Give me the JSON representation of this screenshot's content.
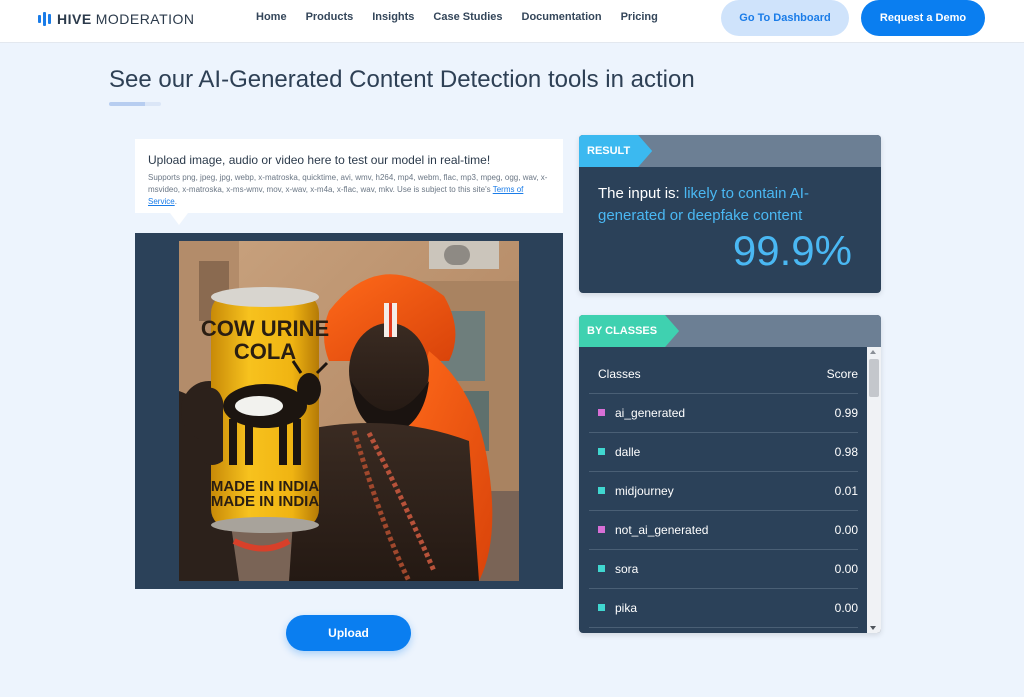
{
  "header": {
    "brand_bold": "HIVE",
    "brand_light": "MODERATION",
    "nav": [
      "Home",
      "Products",
      "Insights",
      "Case Studies",
      "Documentation",
      "Pricing"
    ],
    "dashboard_label": "Go To Dashboard",
    "demo_label": "Request a Demo"
  },
  "page": {
    "title": "See our AI-Generated Content Detection tools in action"
  },
  "upload": {
    "heading": "Upload image, audio or video here to test our model in real-time!",
    "supports_text": "Supports png, jpeg, jpg, webp, x-matroska, quicktime, avi, wmv, h264, mp4, webm, flac, mp3, mpeg, ogg, wav, x-msvideo, x-matroska, x-ms-wmv, mov, x-wav, x-m4a, x-flac, wav, mkv. Use is subject to this site's",
    "terms_link": "Terms of Service",
    "terms_suffix": ".",
    "button_label": "Upload",
    "photo_can_text_1": "COW URINE",
    "photo_can_text_2": "COLA",
    "photo_can_text_3": "MADE IN INDIA",
    "photo_can_text_4": "MADE IN INDIA"
  },
  "result": {
    "tag": "RESULT",
    "prefix": "The input is: ",
    "verdict": "likely to contain AI-generated or deepfake content",
    "percent": "99.9%",
    "accent_color": "#4ab8f3"
  },
  "classes": {
    "tag": "BY CLASSES",
    "col_name": "Classes",
    "col_score": "Score",
    "rows": [
      {
        "name": "ai_generated",
        "score": "0.99",
        "color": "#d86fd6"
      },
      {
        "name": "dalle",
        "score": "0.98",
        "color": "#40d7d0"
      },
      {
        "name": "midjourney",
        "score": "0.01",
        "color": "#40d7d0"
      },
      {
        "name": "not_ai_generated",
        "score": "0.00",
        "color": "#d86fd6"
      },
      {
        "name": "sora",
        "score": "0.00",
        "color": "#40d7d0"
      },
      {
        "name": "pika",
        "score": "0.00",
        "color": "#40d7d0"
      }
    ]
  }
}
